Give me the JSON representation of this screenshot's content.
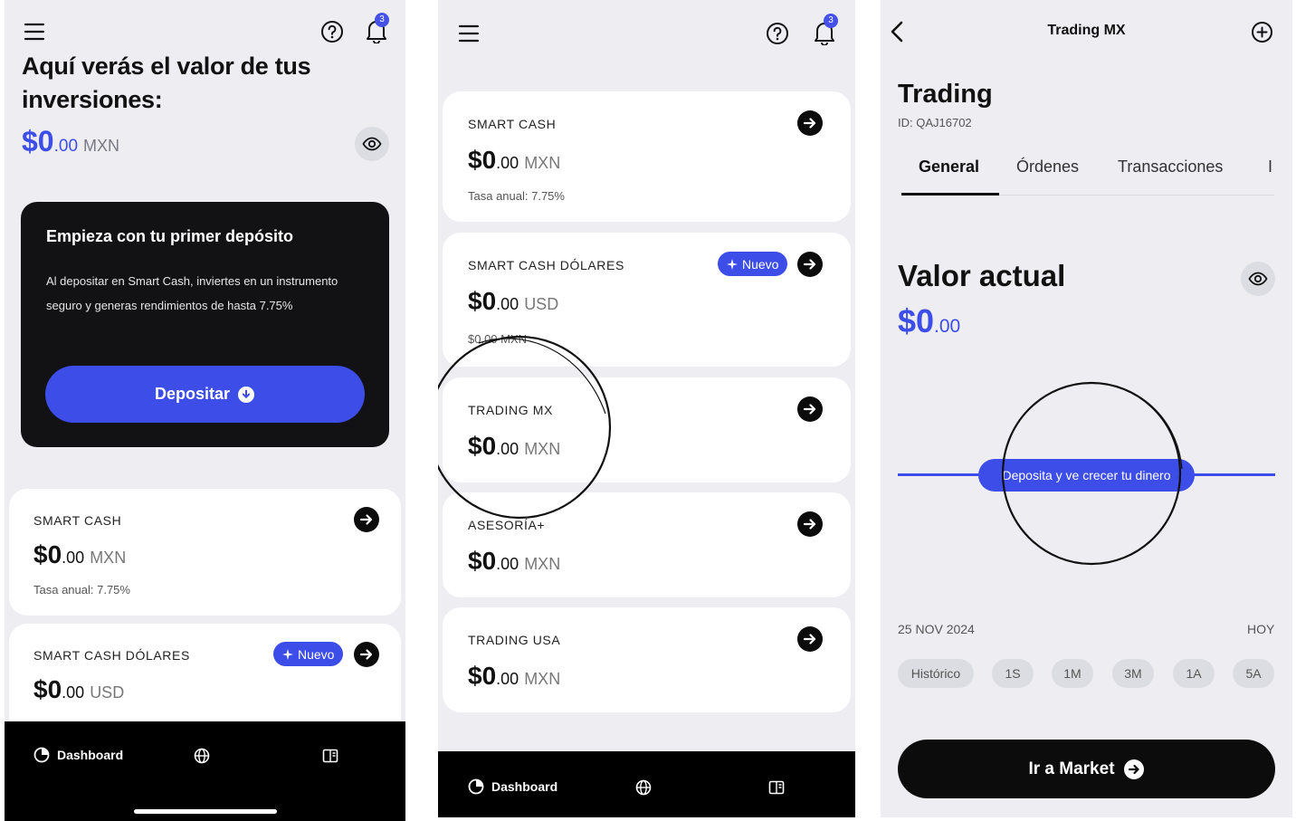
{
  "colors": {
    "accent": "#3d4de8",
    "background": "#ededf2",
    "dark": "#0c0c0c"
  },
  "screen1": {
    "notification_count": "3",
    "title": "Aquí verás el valor de tus inversiones:",
    "balance": {
      "integer": "$0",
      "decimal": ".00",
      "currency": "MXN"
    },
    "promo": {
      "title": "Empieza con tu primer depósito",
      "body": "Al depositar en Smart Cash, inviertes en un instrumento seguro y generas rendimientos de hasta 7.75%",
      "button": "Depositar"
    },
    "cards": [
      {
        "label": "SMART CASH",
        "integer": "$0",
        "decimal": ".00",
        "currency": "MXN",
        "sub": "Tasa anual: 7.75%"
      },
      {
        "label": "SMART CASH DÓLARES",
        "integer": "$0",
        "decimal": ".00",
        "currency": "USD",
        "badge": "Nuevo"
      }
    ],
    "tabbar": {
      "dashboard": "Dashboard"
    }
  },
  "screen2": {
    "notification_count": "3",
    "cards": [
      {
        "label": "SMART CASH",
        "integer": "$0",
        "decimal": ".00",
        "currency": "MXN",
        "sub": "Tasa anual: 7.75%"
      },
      {
        "label": "SMART CASH DÓLARES",
        "integer": "$0",
        "decimal": ".00",
        "currency": "USD",
        "sub": "$0.00 MXN",
        "badge": "Nuevo"
      },
      {
        "label": "TRADING MX",
        "integer": "$0",
        "decimal": ".00",
        "currency": "MXN"
      },
      {
        "label": "ASESORÍA+",
        "integer": "$0",
        "decimal": ".00",
        "currency": "MXN"
      },
      {
        "label": "TRADING USA",
        "integer": "$0",
        "decimal": ".00",
        "currency": "MXN"
      }
    ],
    "tabbar": {
      "dashboard": "Dashboard"
    }
  },
  "screen3": {
    "header_title": "Trading MX",
    "title": "Trading",
    "account_id": "ID: QAJ16702",
    "tabs": [
      "General",
      "Órdenes",
      "Transacciones",
      "I"
    ],
    "valor_title": "Valor actual",
    "valor": {
      "integer": "$0",
      "decimal": ".00"
    },
    "chart_pill": "Deposita y ve crecer tu dinero",
    "date_start": "25 NOV 2024",
    "date_end": "HOY",
    "ranges": [
      "Histórico",
      "1S",
      "1M",
      "3M",
      "1A",
      "5A"
    ],
    "market_button": "Ir a Market"
  },
  "icons": [
    "menu-icon",
    "help-icon",
    "bell-icon",
    "eye-icon",
    "arrow-right-icon",
    "sparkle-icon",
    "download-icon",
    "pie-chart-icon",
    "globe-icon",
    "book-icon",
    "back-icon",
    "plus-circle-icon"
  ]
}
